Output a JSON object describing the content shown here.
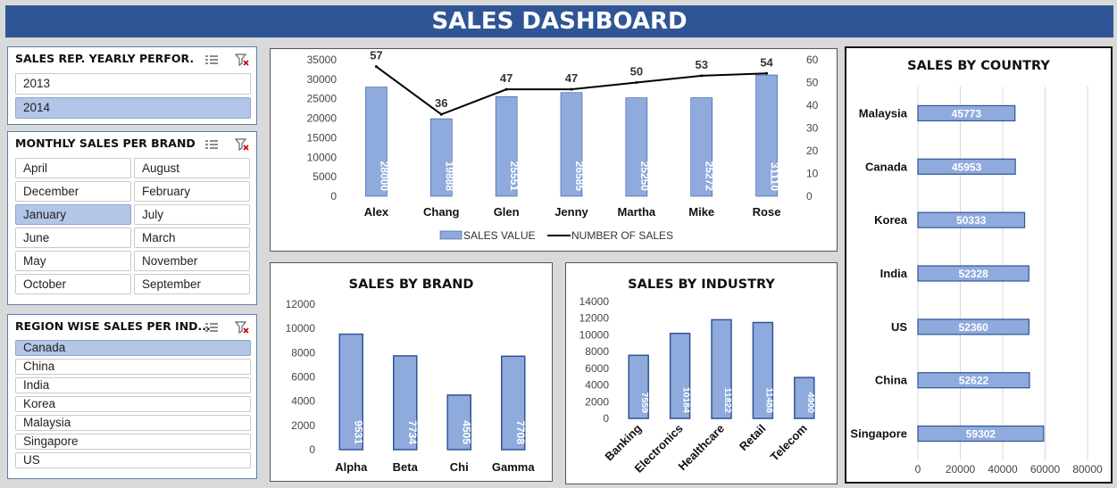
{
  "header": {
    "title": "SALES DASHBOARD"
  },
  "slicers": [
    {
      "title": "SALES REP. YEARLY PERFOR.",
      "items": [
        {
          "label": "2013",
          "selected": false
        },
        {
          "label": "2014",
          "selected": true
        }
      ]
    },
    {
      "title": "MONTHLY SALES PER BRAND",
      "items": [
        {
          "label": "April",
          "selected": false
        },
        {
          "label": "August",
          "selected": false
        },
        {
          "label": "December",
          "selected": false
        },
        {
          "label": "February",
          "selected": false
        },
        {
          "label": "January",
          "selected": true
        },
        {
          "label": "July",
          "selected": false
        },
        {
          "label": "June",
          "selected": false
        },
        {
          "label": "March",
          "selected": false
        },
        {
          "label": "May",
          "selected": false
        },
        {
          "label": "November",
          "selected": false
        },
        {
          "label": "October",
          "selected": false
        },
        {
          "label": "September",
          "selected": false
        }
      ]
    },
    {
      "title": "REGION WISE SALES PER IND...",
      "items": [
        {
          "label": "Canada",
          "selected": true
        },
        {
          "label": "China",
          "selected": false
        },
        {
          "label": "India",
          "selected": false
        },
        {
          "label": "Korea",
          "selected": false
        },
        {
          "label": "Malaysia",
          "selected": false
        },
        {
          "label": "Singapore",
          "selected": false
        },
        {
          "label": "US",
          "selected": false
        }
      ]
    }
  ],
  "colors": {
    "header": "#2f5597",
    "bar": "#8faadc",
    "bar_border": "#2f5597",
    "line": "#000000",
    "selected": "#b4c6e7"
  },
  "chart_data": [
    {
      "id": "sales-rep",
      "type": "bar",
      "title": "",
      "categories": [
        "Alex",
        "Chang",
        "Glen",
        "Jenny",
        "Martha",
        "Mike",
        "Rose"
      ],
      "series": [
        {
          "name": "SALES VALUE",
          "type": "bar",
          "axis": "left",
          "values": [
            28000,
            19888,
            25551,
            26585,
            25250,
            25272,
            31110
          ]
        },
        {
          "name": "NUMBER OF SALES",
          "type": "line",
          "axis": "right",
          "values": [
            57,
            36,
            47,
            47,
            50,
            53,
            54
          ]
        }
      ],
      "ylim": [
        0,
        35000
      ],
      "y2lim": [
        0,
        60
      ],
      "yticks": [
        "35000",
        "30000",
        "25000",
        "20000",
        "15000",
        "10000",
        "5000",
        "0"
      ],
      "y2ticks": [
        "60",
        "50",
        "40",
        "30",
        "20",
        "10",
        "0"
      ],
      "legend": "bottom"
    },
    {
      "id": "brand",
      "type": "bar",
      "title": "SALES BY BRAND",
      "categories": [
        "Alpha",
        "Beta",
        "Chi",
        "Gamma"
      ],
      "values": [
        9531,
        7734,
        4505,
        7708
      ],
      "ylim": [
        0,
        12000
      ],
      "yticks": [
        "12000",
        "10000",
        "8000",
        "6000",
        "4000",
        "2000",
        "0"
      ]
    },
    {
      "id": "industry",
      "type": "bar",
      "title": "SALES BY INDUSTRY",
      "categories": [
        "Banking",
        "Electronics",
        "Healthcare",
        "Retail",
        "Telecom"
      ],
      "values": [
        7559,
        10184,
        11822,
        11488,
        4900
      ],
      "ylim": [
        0,
        14000
      ],
      "yticks": [
        "14000",
        "12000",
        "10000",
        "8000",
        "6000",
        "4000",
        "2000",
        "0"
      ]
    },
    {
      "id": "country",
      "type": "bar",
      "orientation": "horizontal",
      "title": "SALES BY COUNTRY",
      "categories": [
        "Malaysia",
        "Canada",
        "Korea",
        "India",
        "US",
        "China",
        "Singapore"
      ],
      "values": [
        45773,
        45953,
        50333,
        52328,
        52360,
        52622,
        59302
      ],
      "xlim": [
        0,
        80000
      ],
      "xticks": [
        "0",
        "20000",
        "40000",
        "60000",
        "80000"
      ],
      "grid": true
    }
  ]
}
